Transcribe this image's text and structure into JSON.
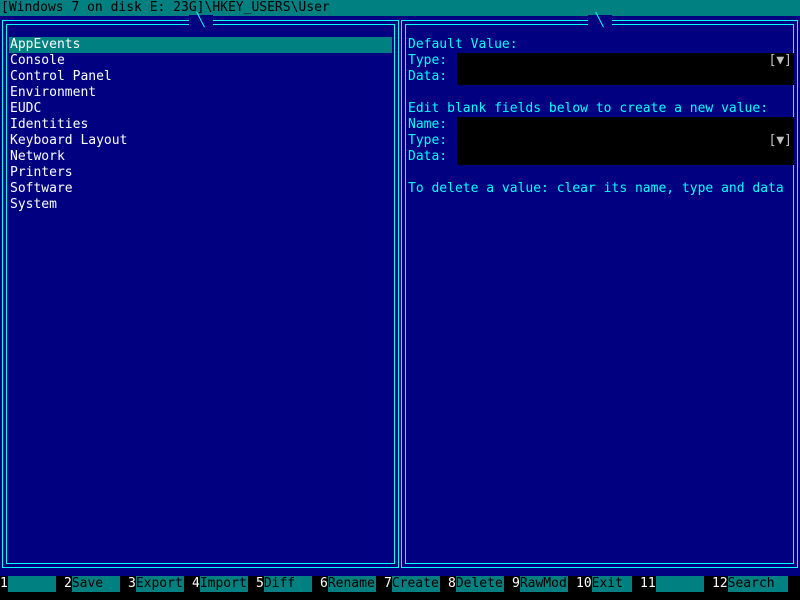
{
  "title": "[Windows 7 on disk E: 23G]\\HKEY_USERS\\User",
  "colors": {
    "background": "#000080",
    "border": "#00ffff",
    "highlight": "#008080"
  },
  "keys": {
    "selected": "AppEvents",
    "items": [
      "AppEvents",
      "Console",
      "Control Panel",
      "Environment",
      "EUDC",
      "Identities",
      "Keyboard Layout",
      "Network",
      "Printers",
      "Software",
      "System"
    ]
  },
  "values": {
    "default_header": "Default Value:",
    "type_label": "Type:",
    "data_label": "Data:",
    "name_label": "Name:",
    "dropdown": "[▼]",
    "default_type": "",
    "default_data": "",
    "new_header": "Edit blank fields below to create a new value:",
    "new_name": "",
    "new_type": "",
    "new_data": "",
    "delete_hint": "To delete a value: clear its name, type and data"
  },
  "function_keys": [
    {
      "num": "1",
      "label": ""
    },
    {
      "num": "2",
      "label": "Save"
    },
    {
      "num": "3",
      "label": "Export"
    },
    {
      "num": "4",
      "label": "Import"
    },
    {
      "num": "5",
      "label": "Diff"
    },
    {
      "num": "6",
      "label": "Rename"
    },
    {
      "num": "7",
      "label": "Create"
    },
    {
      "num": "8",
      "label": "Delete"
    },
    {
      "num": "9",
      "label": "RawMod"
    },
    {
      "num": "10",
      "label": "Exit"
    },
    {
      "num": "11",
      "label": ""
    },
    {
      "num": "12",
      "label": "Search"
    }
  ]
}
